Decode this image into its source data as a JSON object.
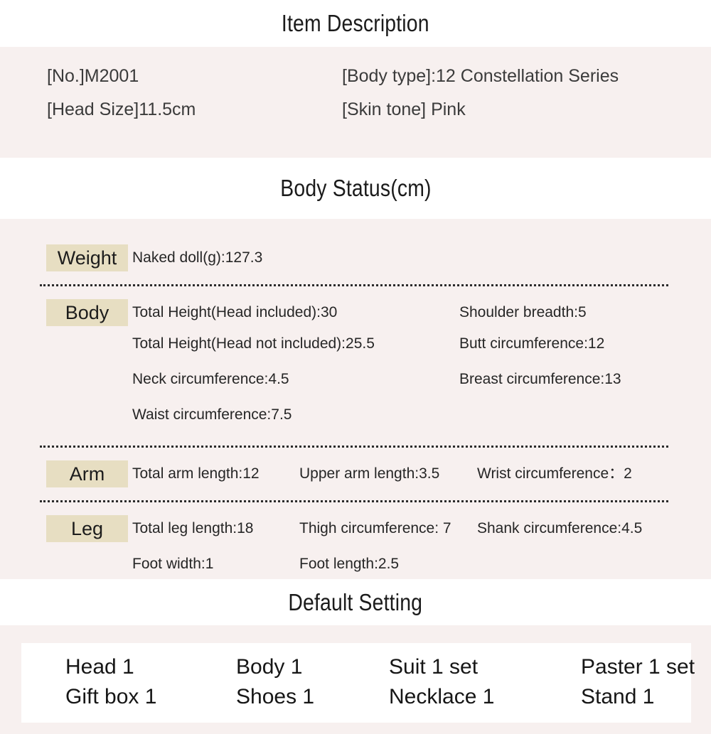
{
  "sections": {
    "item_description": {
      "title": "Item Description",
      "fields": [
        {
          "label": "[No.]M2001"
        },
        {
          "label": "[Body type]:12 Constellation Series"
        },
        {
          "label": "[Head Size]11.5cm"
        },
        {
          "label": "[Skin tone] Pink"
        }
      ]
    },
    "body_status": {
      "title": "Body Status(cm)",
      "groups": [
        {
          "label": "Weight",
          "layout": "single",
          "values": [
            "Naked doll(g):127.3"
          ]
        },
        {
          "label": "Body",
          "layout": "two-column",
          "values": [
            "Total Height(Head included):30",
            "Shoulder breadth:5",
            "Total Height(Head not included):25.5",
            "Butt circumference:12",
            "Neck circumference:4.5",
            "Breast circumference:13",
            "Waist circumference:7.5"
          ]
        },
        {
          "label": "Arm",
          "layout": "three-column",
          "values": [
            "Total arm length:12",
            "Upper arm length:3.5",
            "Wrist circumference：2"
          ]
        },
        {
          "label": "Leg",
          "layout": "three-column",
          "values": [
            "Total leg length:18",
            "Thigh circumference: 7",
            "Shank circumference:4.5",
            "Foot width:1",
            "Foot length:2.5"
          ]
        }
      ]
    },
    "default_setting": {
      "title": "Default Setting",
      "items": [
        "Head 1",
        "Body 1",
        "Suit 1 set",
        "Paster 1 set",
        "Gift box 1",
        "Shoes 1",
        "Necklace 1",
        "Stand 1"
      ]
    }
  },
  "colors": {
    "page_background": "#ffffff",
    "band_background": "#f7f0ef",
    "label_highlight": "#e7dec2",
    "text": "#231f20",
    "separator": "#2b2b2b"
  }
}
